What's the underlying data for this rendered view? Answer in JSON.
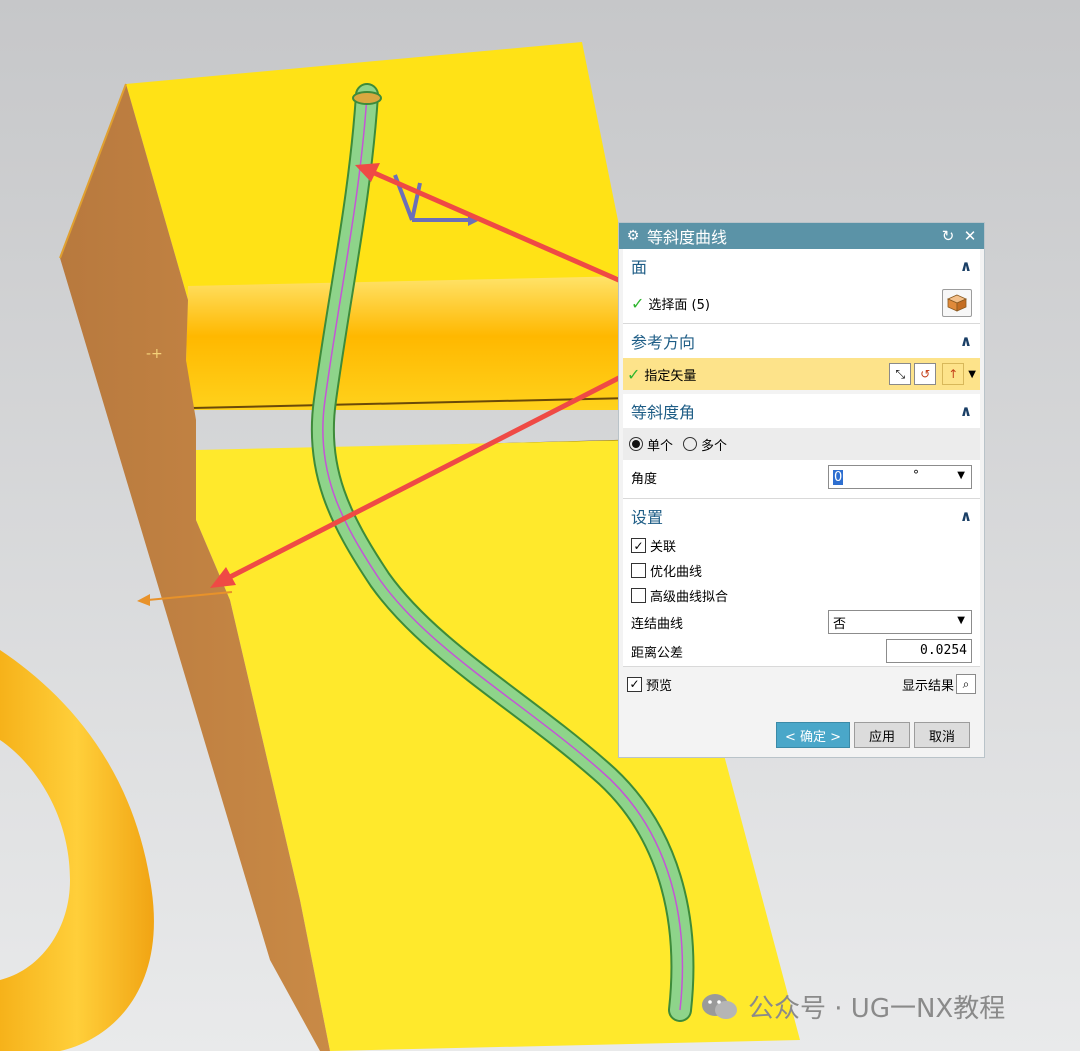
{
  "dialog": {
    "title": "等斜度曲线",
    "sections": {
      "face": {
        "label": "面",
        "select_face": "选择面 (5)"
      },
      "ref_dir": {
        "label": "参考方向",
        "specify_vector": "指定矢量"
      },
      "slope_angle": {
        "label": "等斜度角",
        "options": [
          "单个",
          "多个"
        ],
        "selected_option": "单个",
        "angle_label": "角度",
        "angle_value": "0",
        "angle_unit": "°"
      },
      "settings": {
        "label": "设置",
        "associative": "关联",
        "optimize_curve": "优化曲线",
        "advanced_fit": "高级曲线拟合",
        "join_curves_label": "连结曲线",
        "join_curves_value": "否",
        "distance_tol_label": "距离公差",
        "distance_tol_value": "0.0254"
      }
    },
    "preview": "预览",
    "show_result": "显示结果",
    "buttons": {
      "ok": "< 确定 >",
      "apply": "应用",
      "cancel": "取消"
    },
    "checked": {
      "associative": true,
      "optimize_curve": false,
      "advanced_fit": false,
      "preview": true
    }
  },
  "watermark": "公众号 · UG一NX教程",
  "colors": {
    "titlebar": "#5b93a7",
    "section_header": "#1e5d86",
    "highlight_row": "#fde38a",
    "model_yellow": "#ffe82a",
    "tube_green": "#8dd486",
    "arrow_red": "#ef4a45"
  }
}
